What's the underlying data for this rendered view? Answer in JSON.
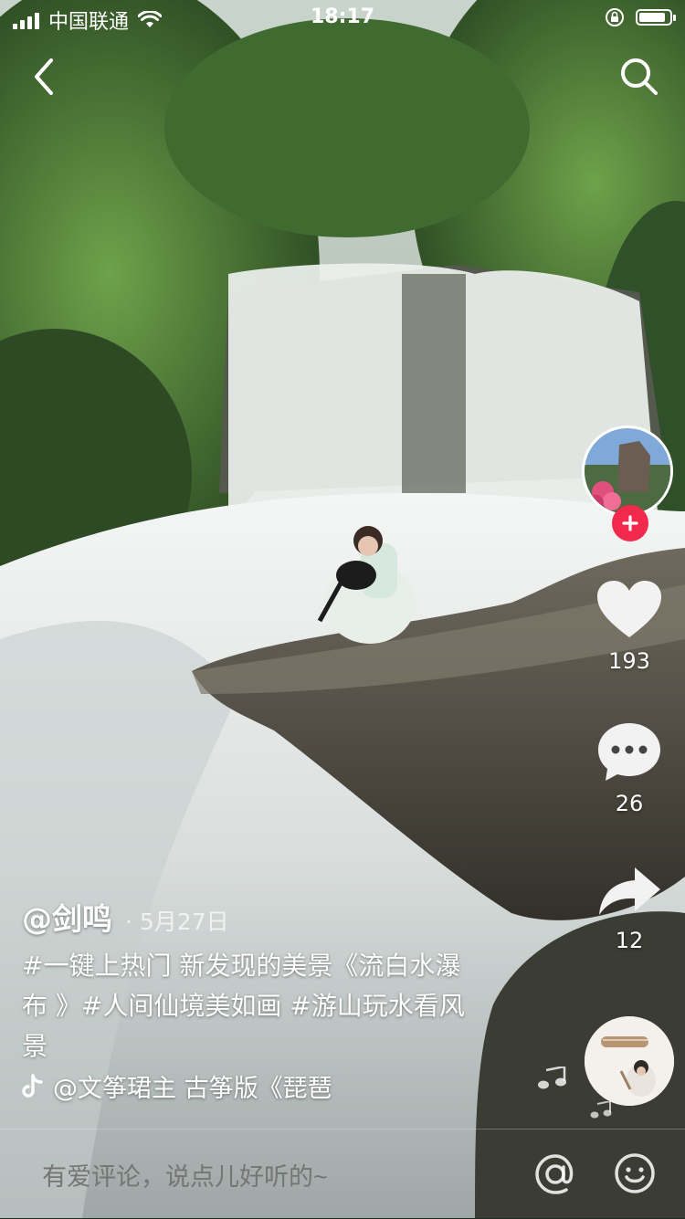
{
  "status_bar": {
    "carrier": "中国联通",
    "time": "18:17",
    "battery_level": 0.9
  },
  "icons": {
    "back": "chevron-left-icon",
    "search": "search-icon",
    "like": "heart-icon",
    "comment": "comment-bubble-icon",
    "share": "share-arrow-icon",
    "follow": "plus-icon",
    "music": "tiktok-note-icon",
    "at": "at-icon",
    "emoji": "emoji-smile-icon"
  },
  "actions": {
    "likes": "193",
    "comments": "26",
    "shares": "12"
  },
  "post": {
    "author": "@剑鸣",
    "date": "· 5月27日",
    "caption_lines": [
      "#一键上热门  新发现的美景《流白水瀑",
      "布 》#人间仙境美如画 #游山玩水看风",
      "景"
    ],
    "music": "@文筝珺主    古筝版《琵琶"
  },
  "comment_bar": {
    "placeholder": "有爱评论，说点儿好听的~"
  },
  "colors": {
    "follow_red": "#f0294d",
    "heart_white": "#ffffff"
  }
}
